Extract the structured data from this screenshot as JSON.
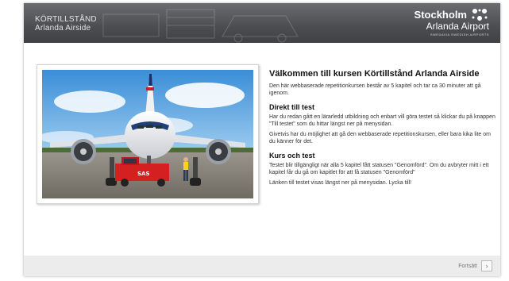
{
  "header": {
    "course_title_line1": "KÖRTILLSTÅND",
    "course_title_line2": "Arlanda Airside",
    "logo_line1": "Stockholm",
    "logo_line2": "Arlanda Airport",
    "logo_line3": "SWEDAVIA SWEDISH AIRPORTS",
    "logo_icon": "crown-icon"
  },
  "main": {
    "heading": "Välkommen till kursen Körtillstånd Arlanda Airside",
    "intro": "Den här webbaserade repetitionkursen består av 5 kapitel och tar ca 30 minuter att gå igenom.",
    "section1_title": "Direkt till test",
    "section1_p1": "Har du redan gått en lärarledd utbildning och enbart vill göra testet så klickar du på knappen \"Till testet\" som du hittar längst ner på menysidan.",
    "section1_p2": "Givetvis har du möjlighet att gå den webbaserade repetitionskursen, eller bara kika lite om du känner för det.",
    "section2_title": "Kurs och test",
    "section2_p1": "Testet blir tillgängligt när alla 5 kapitel fått statusen \"Genomförd\". Om du avbryter mitt i ett kapitel får du gå om kapitlet för att få statusen \"Genomförd\"",
    "section2_p2": "Länken till testet visas längst ner på menysidan. Lycka till!",
    "image_subject": "airplane-with-tug-photo",
    "tug_label": "SAS"
  },
  "footer": {
    "next_label": "Fortsätt",
    "next_icon": "chevron-right-icon"
  },
  "colors": {
    "header_bg": "#4b4d51",
    "frame_bg": "#ececec",
    "text": "#333333",
    "tug_red": "#d42020"
  }
}
